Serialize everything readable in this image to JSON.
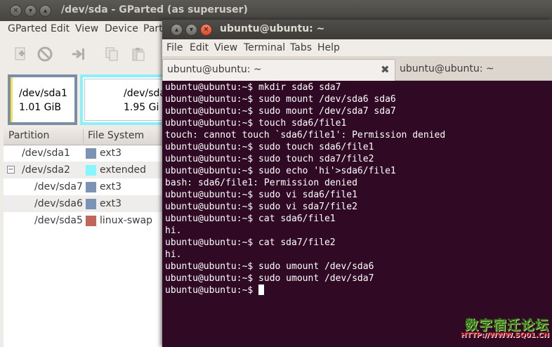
{
  "gparted": {
    "title": "/dev/sda - GParted (as superuser)",
    "menu": [
      "GParted",
      "Edit",
      "View",
      "Device",
      "Parti"
    ],
    "toolbar_icons": [
      "new-icon",
      "delete-icon",
      "resize-icon",
      "copy-icon",
      "paste-icon"
    ],
    "diskmap": {
      "sda1": {
        "name": "/dev/sda1",
        "size": "1.01 GiB"
      },
      "sda2": {
        "name": "/dev/sda",
        "size": "1.95 Gi"
      }
    },
    "table": {
      "columns": [
        "Partition",
        "File System"
      ],
      "rows": [
        {
          "partition": "/dev/sda1",
          "filesystem": "ext3",
          "color": "#7b94b6"
        },
        {
          "partition": "/dev/sda2",
          "filesystem": "extended",
          "color": "#86f6ff"
        },
        {
          "partition": "/dev/sda7",
          "filesystem": "ext3",
          "color": "#7b94b6"
        },
        {
          "partition": "/dev/sda6",
          "filesystem": "ext3",
          "color": "#7b94b6"
        },
        {
          "partition": "/dev/sda5",
          "filesystem": "linux-swap",
          "color": "#c1665a"
        }
      ]
    }
  },
  "terminal": {
    "title": "ubuntu@ubuntu: ~",
    "menu": [
      "File",
      "Edit",
      "View",
      "Terminal",
      "Tabs",
      "Help"
    ],
    "tabs": [
      {
        "label": "ubuntu@ubuntu: ~"
      },
      {
        "label": "ubuntu@ubuntu: ~"
      }
    ],
    "tab_close_glyph": "✖",
    "lines": [
      "ubuntu@ubuntu:~$ mkdir sda6 sda7",
      "ubuntu@ubuntu:~$ sudo mount /dev/sda6 sda6",
      "ubuntu@ubuntu:~$ sudo mount /dev/sda7 sda7",
      "ubuntu@ubuntu:~$ touch sda6/file1",
      "touch: cannot touch `sda6/file1': Permission denied",
      "ubuntu@ubuntu:~$ sudo touch sda6/file1",
      "ubuntu@ubuntu:~$ sudo touch sda7/file2",
      "ubuntu@ubuntu:~$ sudo echo 'hi'>sda6/file1",
      "bash: sda6/file1: Permission denied",
      "ubuntu@ubuntu:~$ sudo vi sda6/file1",
      "ubuntu@ubuntu:~$ sudo vi sda7/file2",
      "ubuntu@ubuntu:~$ cat sda6/file1",
      "hi.",
      "ubuntu@ubuntu:~$ cat sda7/file2",
      "hi.",
      "ubuntu@ubuntu:~$ sudo umount /dev/sda6",
      "ubuntu@ubuntu:~$ sudo umount /dev/sda7"
    ],
    "prompt": "ubuntu@ubuntu:~$ ",
    "colors": {
      "background": "#300a24",
      "text": "#ffffff"
    }
  },
  "watermark": {
    "chinese": "数字宿迁论坛",
    "url": "HTTP://WWW.SQ01.CN"
  }
}
